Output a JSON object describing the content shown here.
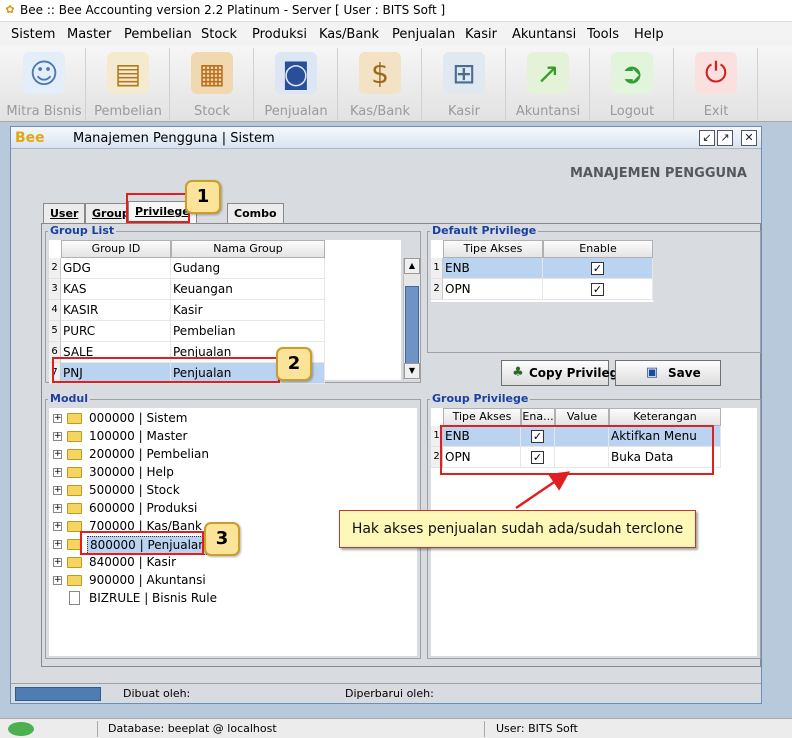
{
  "window": {
    "title": "Bee :: Bee Accounting version 2.2 Platinum - Server  [ User : BITS Soft ]"
  },
  "menu": [
    "Sistem",
    "Master",
    "Pembelian",
    "Stock",
    "Produksi",
    "Kas/Bank",
    "Penjualan",
    "Kasir",
    "Akuntansi",
    "Tools",
    "Help"
  ],
  "toolbar": [
    {
      "label": "Mitra Bisnis",
      "icon": "people-icon"
    },
    {
      "label": "Pembelian",
      "icon": "invoice-icon"
    },
    {
      "label": "Stock",
      "icon": "boxes-icon"
    },
    {
      "label": "Penjualan",
      "icon": "shopping-bag-icon"
    },
    {
      "label": "Kas/Bank",
      "icon": "money-bag-icon"
    },
    {
      "label": "Kasir",
      "icon": "cart-icon"
    },
    {
      "label": "Akuntansi",
      "icon": "chart-up-icon"
    },
    {
      "label": "Logout",
      "icon": "logout-arrow-icon"
    },
    {
      "label": "Exit",
      "icon": "power-icon"
    }
  ],
  "child_window": {
    "title": "Manajemen Pengguna | Sistem",
    "logo_text": "Bee",
    "heading": "MANAJEMEN PENGGUNA"
  },
  "tabs": [
    "User",
    "Group",
    "Privilege",
    "Combo"
  ],
  "group_list": {
    "label": "Group List",
    "headers": [
      "Group ID",
      "Nama Group"
    ],
    "rows": [
      {
        "n": "2",
        "id": "GDG",
        "name": "Gudang"
      },
      {
        "n": "3",
        "id": "KAS",
        "name": "Keuangan"
      },
      {
        "n": "4",
        "id": "KASIR",
        "name": "Kasir"
      },
      {
        "n": "5",
        "id": "PURC",
        "name": "Pembelian"
      },
      {
        "n": "6",
        "id": "SALE",
        "name": "Penjualan"
      },
      {
        "n": "7",
        "id": "PNJ",
        "name": "Penjualan"
      }
    ]
  },
  "default_privilege": {
    "label": "Default Privilege",
    "headers": [
      "Tipe Akses",
      "Enable"
    ],
    "rows": [
      {
        "n": "1",
        "tipe": "ENB",
        "enable": "✓"
      },
      {
        "n": "2",
        "tipe": "OPN",
        "enable": "✓"
      }
    ]
  },
  "buttons": {
    "copy": "Copy Privilege",
    "save": "Save"
  },
  "modul": {
    "label": "Modul",
    "items": [
      "000000 | Sistem",
      "100000 | Master",
      "200000 | Pembelian",
      "300000 | Help",
      "500000 | Stock",
      "600000 | Produksi",
      "700000 | Kas/Bank",
      "800000 | Penjualan",
      "840000 | Kasir",
      "900000 | Akuntansi",
      "BIZRULE | Bisnis Rule"
    ]
  },
  "group_privilege": {
    "label": "Group Privilege",
    "headers": [
      "Tipe Akses",
      "Ena...",
      "Value",
      "Keterangan"
    ],
    "rows": [
      {
        "n": "1",
        "tipe": "ENB",
        "enable": "✓",
        "value": "",
        "keterangan": "Aktifkan Menu"
      },
      {
        "n": "2",
        "tipe": "OPN",
        "enable": "✓",
        "value": "",
        "keterangan": "Buka Data"
      }
    ]
  },
  "annotations": {
    "badge1": "1",
    "badge2": "2",
    "badge3": "3",
    "callout": "Hak akses penjualan sudah ada/sudah terclone"
  },
  "child_status": {
    "created": "Dibuat oleh:",
    "updated": "Diperbarui oleh:"
  },
  "main_status": {
    "database": "Database: beeplat @ localhost",
    "user": "User: BITS Soft"
  },
  "colors": {
    "highlight": "#b9d3f0",
    "annotation_red": "#e02020",
    "group_label": "#1b3fa0"
  }
}
